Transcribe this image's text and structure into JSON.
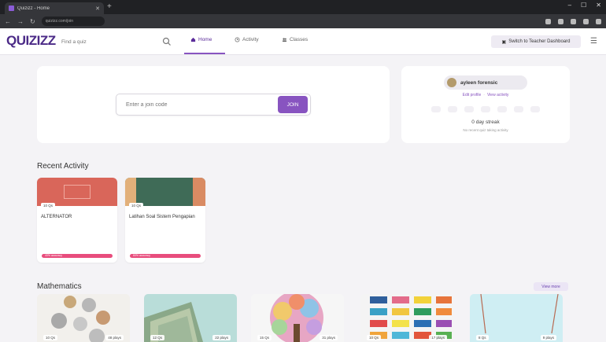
{
  "browser": {
    "tab_title": "Quizizz - Home",
    "url": "quizizz.com/join"
  },
  "header": {
    "logo": "QUIZIZZ",
    "search_placeholder": "Find a quiz",
    "nav": [
      {
        "label": "Home"
      },
      {
        "label": "Activity"
      },
      {
        "label": "Classes"
      }
    ],
    "dashboard_label": "Switch to Teacher Dashboard"
  },
  "join": {
    "placeholder": "Enter a join code",
    "button": "JOIN"
  },
  "profile": {
    "name": "ayleen forensic",
    "edit_label": "Edit profile",
    "activity_label": "View activity",
    "streak": "0 day streak",
    "streak_sub": "No recent quiz taking activity"
  },
  "recent": {
    "title": "Recent Activity",
    "cards": [
      {
        "name": "ALTERNATOR",
        "count": "10 Qs",
        "progress": "40% accuracy",
        "thumb_color": "#d9665a"
      },
      {
        "name": "Latihan Soal Sistem Pengapian",
        "count": "10 Qs",
        "progress": "60% accuracy",
        "thumb_color": "#3f6b57"
      }
    ]
  },
  "math": {
    "title": "Mathematics",
    "view_more": "View more",
    "cards": [
      {
        "meta_left": "10 Qs",
        "meta_right": "48 plays"
      },
      {
        "meta_left": "12 Qs",
        "meta_right": "22 plays"
      },
      {
        "meta_left": "15 Qs",
        "meta_right": "31 plays"
      },
      {
        "meta_left": "10 Qs",
        "meta_right": "17 plays"
      },
      {
        "meta_left": "8 Qs",
        "meta_right": "9 plays"
      }
    ]
  },
  "colors": {
    "brand": "#8854c0",
    "logo": "#4b2a87",
    "progress": "#e84d7d",
    "background": "#f4f3f6"
  },
  "icons": {
    "search": "search-icon",
    "home": "home-icon",
    "activity": "clock-icon",
    "classes": "people-icon",
    "menu": "menu-icon"
  }
}
